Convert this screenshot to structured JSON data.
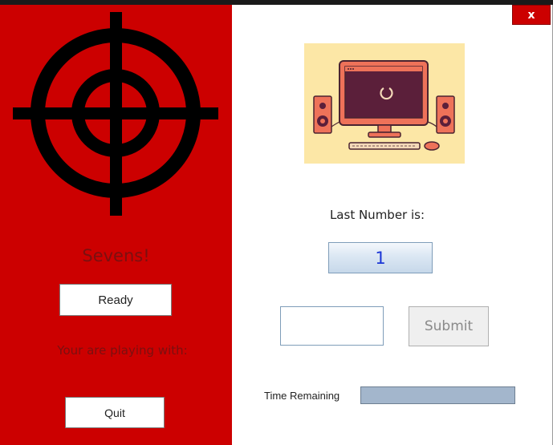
{
  "window": {
    "close_label": "x"
  },
  "left_panel": {
    "game_title": "Sevens!",
    "ready_label": "Ready",
    "playing_with_text": "Your are playing with:",
    "quit_label": "Quit",
    "background_color": "#cc0000",
    "crosshair_icon": "crosshair-icon"
  },
  "main": {
    "illustration_icon": "computer-loading-illustration",
    "last_number_label": "Last Number is:",
    "last_number_value": "1",
    "answer_value": "",
    "submit_label": "Submit",
    "time_remaining_label": "Time Remaining",
    "time_remaining_fraction": 1.0
  }
}
